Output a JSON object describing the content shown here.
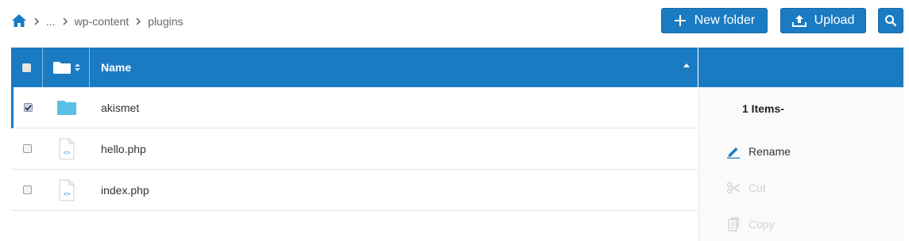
{
  "breadcrumb": {
    "home_icon": "home-icon",
    "items": [
      "...",
      "wp-content",
      "plugins"
    ]
  },
  "toolbar": {
    "new_folder_label": "New folder",
    "upload_label": "Upload",
    "search_icon": "search-icon"
  },
  "table": {
    "headers": {
      "name": "Name"
    },
    "sort": "ascending",
    "rows": [
      {
        "name": "akismet",
        "type": "folder",
        "checked": true
      },
      {
        "name": "hello.php",
        "type": "php-file",
        "checked": false
      },
      {
        "name": "index.php",
        "type": "php-file",
        "checked": false
      }
    ]
  },
  "side_panel": {
    "count_label": "1 Items-",
    "actions": [
      {
        "label": "Rename",
        "enabled": true,
        "icon": "pencil-icon"
      },
      {
        "label": "Cut",
        "enabled": false,
        "icon": "scissors-icon"
      },
      {
        "label": "Copy",
        "enabled": false,
        "icon": "copy-icon"
      }
    ]
  },
  "colors": {
    "accent": "#1a7bc2",
    "folder": "#5bc0e8",
    "disabled": "#d2d2d2"
  }
}
